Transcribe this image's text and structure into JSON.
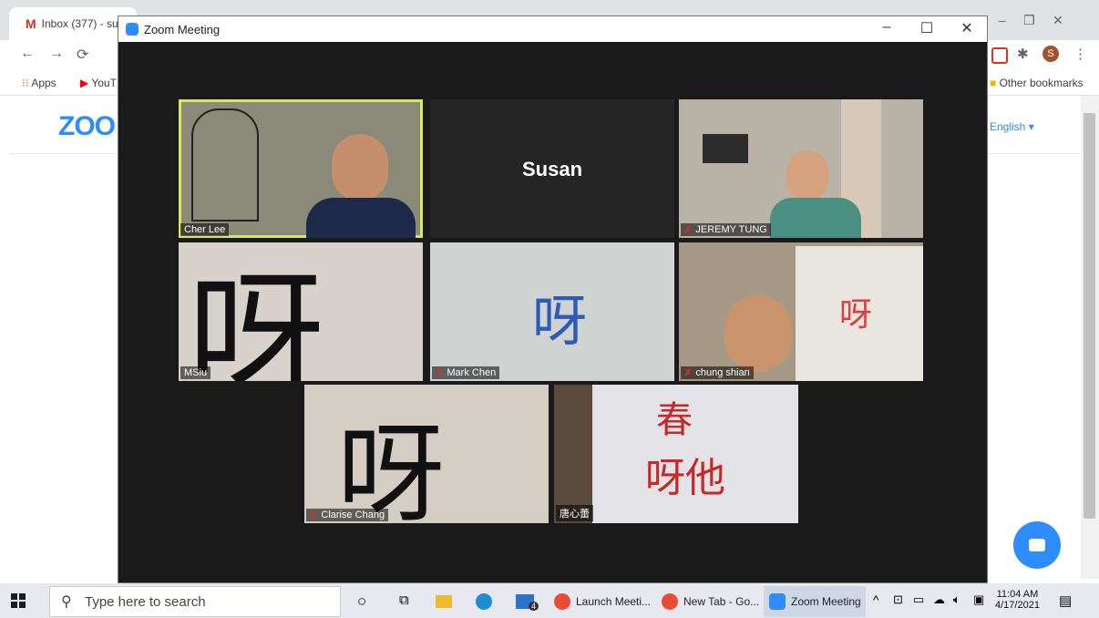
{
  "browser": {
    "tab_title": "Inbox (377) - su",
    "bookmarks": {
      "apps": "Apps",
      "youtube": "YouT",
      "other": "Other bookmarks"
    },
    "language_selector": "English ▾",
    "zoom_logo": "ZOO"
  },
  "zoom": {
    "window_title": "Zoom Meeting",
    "controls": {
      "minimize": "–",
      "maximize": "☐",
      "close": "✕"
    },
    "participants": [
      {
        "name": "Cher Lee",
        "muted": false,
        "active_speaker": true
      },
      {
        "name": "Susan",
        "muted": false,
        "video": false
      },
      {
        "name": "JEREMY TUNG",
        "muted": true
      },
      {
        "name": "MSiu",
        "muted": false
      },
      {
        "name": "Mark Chen",
        "muted": true
      },
      {
        "name": "chung shian",
        "muted": true
      },
      {
        "name": "Clarise Chang",
        "muted": true
      },
      {
        "name": "唐心蕾",
        "muted": false
      }
    ],
    "handwriting": {
      "ya": "呀",
      "line1": "春",
      "line2": "呀他"
    }
  },
  "taskbar": {
    "search_placeholder": "Type here to search",
    "apps": [
      {
        "label": "Launch Meeti..."
      },
      {
        "label": "New Tab - Go..."
      },
      {
        "label": "Zoom Meeting"
      }
    ],
    "mail_badge": "4",
    "time": "11:04 AM",
    "date": "4/17/2021"
  },
  "colors": {
    "zoom_blue": "#2d8cff",
    "active_speaker_border": "#d6e85a",
    "muted_red": "#e02828"
  }
}
